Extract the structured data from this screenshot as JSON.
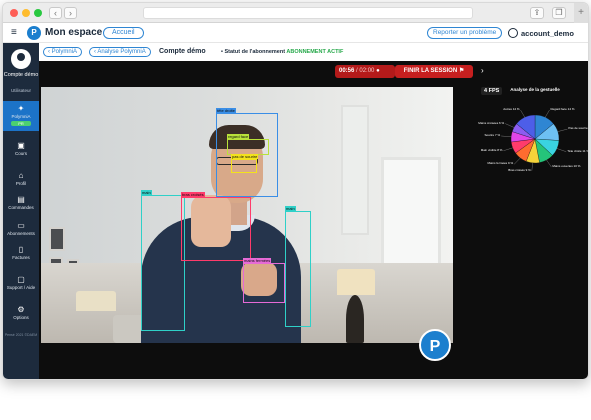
{
  "header": {
    "app_title": "Mon espace",
    "accueil_label": "Accueil",
    "report_label": "Reporter un problème",
    "account_name": "account_demo"
  },
  "sidebar": {
    "user_name": "Compte démo",
    "user_role": "Utilisateur",
    "items": [
      {
        "label": "PolymniA",
        "icon": "polymnia-icon",
        "badge": "PR"
      },
      {
        "label": "Cours",
        "icon": "courses-icon"
      },
      {
        "label": "Profil",
        "icon": "home-icon"
      },
      {
        "label": "Commandes",
        "icon": "orders-icon"
      },
      {
        "label": "Abonnements",
        "icon": "subscriptions-icon"
      },
      {
        "label": "Factures",
        "icon": "invoices-icon"
      },
      {
        "label": "Support / Aide",
        "icon": "support-icon"
      },
      {
        "label": "Options",
        "icon": "gear-icon"
      }
    ],
    "footer": "Pensé 2021 ©DAEM"
  },
  "subheader": {
    "crumb1": "PolymniA",
    "crumb2": "Analyse PolymniA",
    "title": "Compte démo",
    "status_prefix": "Statut de l'abonnement",
    "status_value": "ABONNEMENT ACTIF"
  },
  "session": {
    "elapsed": "00:56",
    "total": "/ 02:00",
    "finish_label": "FINIR LA SESSION",
    "fps": "4 FPS"
  },
  "detections": [
    {
      "label": "tête droite",
      "color": "#3a8ee6"
    },
    {
      "label": "regard face",
      "color": "#b9e23a"
    },
    {
      "label": "pas de sourire",
      "color": "#f3e31c"
    },
    {
      "label": "main",
      "color": "#2fd0c8"
    },
    {
      "label": "bras croisés",
      "color": "#ff3b6b"
    },
    {
      "label": "main",
      "color": "#2fd0c8"
    },
    {
      "label": "mains fermées",
      "color": "#e66ad6"
    }
  ],
  "chart_data": {
    "type": "pie",
    "title": "Analyse de la gestuelle",
    "categories": [
      "Regard face",
      "Pas de sourire",
      "Tête droite",
      "Mains ouvertes",
      "Bras croisés",
      "Mains fermées",
      "Main visible",
      "Sourire",
      "Mains croisées",
      "Autres"
    ],
    "values": [
      14,
      12,
      11,
      10,
      9,
      9,
      8,
      7,
      6,
      14
    ],
    "colors": [
      "#2f86d3",
      "#6ec0f3",
      "#3ad3e0",
      "#25c47a",
      "#f5d33a",
      "#ff6c2f",
      "#ff3b6b",
      "#e045e8",
      "#8d5cf0",
      "#4d5ee8"
    ],
    "legend": "around"
  }
}
